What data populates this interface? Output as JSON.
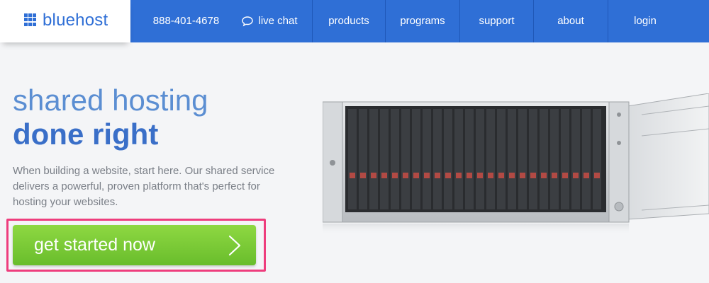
{
  "nav": {
    "logo_text": "bluehost",
    "phone": "888-401-4678",
    "chat_label": "live chat",
    "items": [
      {
        "label": "products"
      },
      {
        "label": "programs"
      },
      {
        "label": "support"
      },
      {
        "label": "about"
      },
      {
        "label": "login"
      }
    ]
  },
  "hero": {
    "title_line1": "shared hosting",
    "title_line2": "done right",
    "description": "When building a website, start here. Our shared service delivers a powerful, proven platform that's perfect for hosting your websites.",
    "cta_label": "get started now"
  },
  "colors": {
    "brand_blue": "#2f6fd6",
    "cta_green": "#7ccb38",
    "highlight_pink": "#ee3d7d"
  },
  "icons": {
    "logo": "grid-logo-icon",
    "chat": "chat-bubble-icon",
    "cta": "chevron-right-icon"
  }
}
